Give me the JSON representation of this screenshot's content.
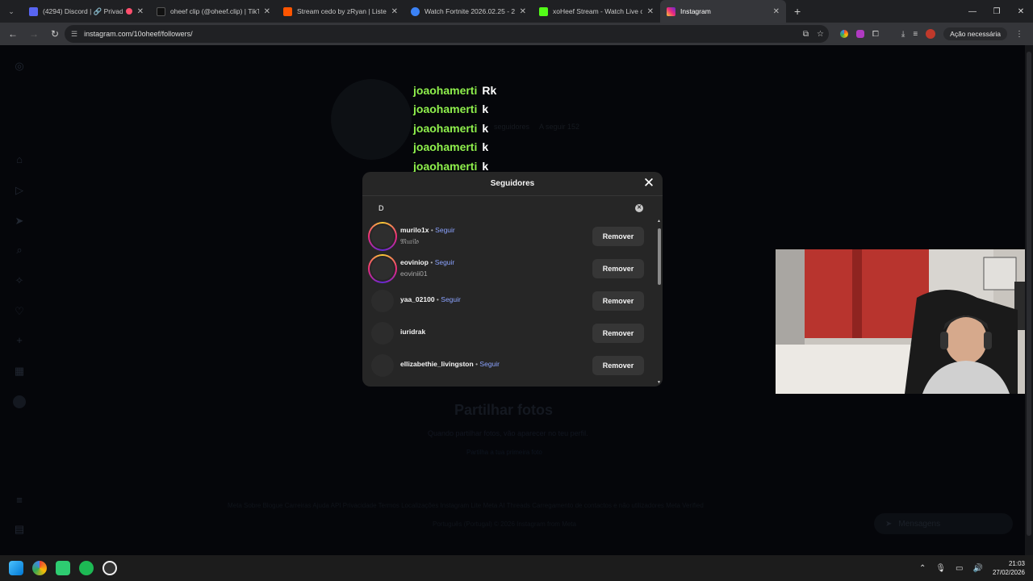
{
  "browser": {
    "tabs": [
      {
        "title": "(4294) Discord | 🔗 Privad",
        "color": "#5865f2",
        "active": false
      },
      {
        "title": "oheef clip (@oheef.clip) | TikTok",
        "color": "#111111",
        "active": false
      },
      {
        "title": "Stream cedo by zRyan | Listen o",
        "color": "#ff5500",
        "active": false
      },
      {
        "title": "Watch Fortnite 2026.02.25 - 22",
        "color": "#3b82f6",
        "active": false
      },
      {
        "title": "xoHeef Stream - Watch Live on",
        "color": "#53fc18",
        "active": false
      },
      {
        "title": "Instagram",
        "color": "#e1306c",
        "active": true
      }
    ],
    "url": "instagram.com/10oheef/followers/",
    "action_label": "Ação necessária"
  },
  "chat": [
    {
      "user": "joaohamerti",
      "message": "Rk"
    },
    {
      "user": "joaohamerti",
      "message": "k"
    },
    {
      "user": "joaohamerti",
      "message": "k"
    },
    {
      "user": "joaohamerti",
      "message": "k"
    },
    {
      "user": "joaohamerti",
      "message": "k"
    }
  ],
  "background_page": {
    "stats_following": "A seguir 152",
    "followers_label": "seguidores",
    "empty_title": "Partilhar fotos",
    "empty_subtitle": "Quando partilhar fotos, vão aparecer no teu perfil.",
    "empty_link": "Partilha a tua primeira foto",
    "footer": "Meta   Sobre   Blogue   Carreiras   Ajuda   API   Privacidade   Termos   Localizações   Instagram Lite   Meta AI   Threads   Carregamento de contactos e não utilizadores   Meta Verified",
    "language": "Português (Portugal)   © 2026 Instagram from Meta",
    "messages_label": "Mensagens"
  },
  "modal": {
    "title": "Seguidores",
    "search_value": "D",
    "followers": [
      {
        "username": "murilo1x",
        "fullname": "𝔐𝔲𝔯𝔦𝔩𝔬",
        "seguir": "Seguir",
        "ring": true
      },
      {
        "username": "eoviniop",
        "fullname": "eovinii01",
        "seguir": "Seguir",
        "ring": true
      },
      {
        "username": "yaa_02100",
        "fullname": "",
        "seguir": "Seguir",
        "ring": false
      },
      {
        "username": "iuridrak",
        "fullname": "",
        "seguir": "",
        "ring": false
      },
      {
        "username": "ellizabethie_livingston",
        "fullname": "",
        "seguir": "Seguir",
        "ring": false
      }
    ],
    "remove_label": "Remover",
    "dot_separator": "•"
  },
  "taskbar": {
    "time": "21:03",
    "date": "27/02/2026"
  }
}
